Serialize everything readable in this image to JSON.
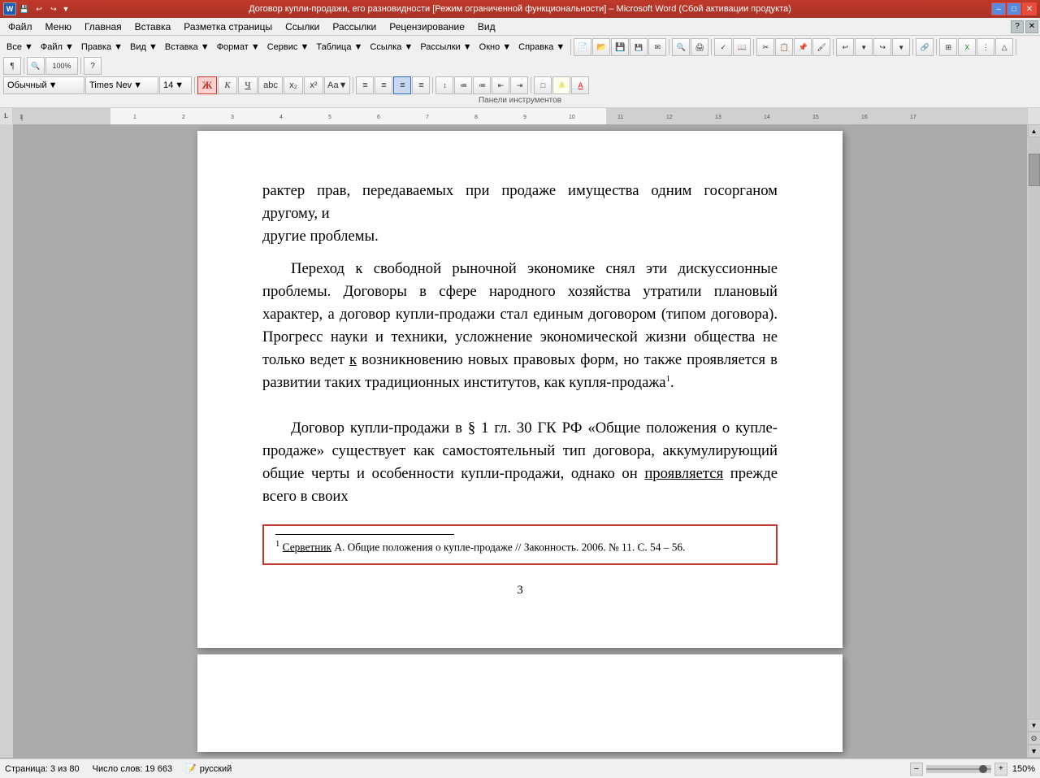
{
  "titlebar": {
    "title": "Договор купли-продажи, его разновидности [Режим ограниченной функциональности] – Microsoft Word (Сбой активации продукта)",
    "min_label": "–",
    "max_label": "□",
    "close_label": "✕"
  },
  "menubar": {
    "items": [
      "Файл",
      "Меню",
      "Главная",
      "Вставка",
      "Разметка страницы",
      "Ссылки",
      "Рассылки",
      "Рецензирование",
      "Вид"
    ]
  },
  "ribbon": {
    "items": [
      "Все▼",
      "Файл▼",
      "Правка▼",
      "Вид▼",
      "Вставка▼",
      "Формат▼",
      "Сервис▼",
      "Таблица▼",
      "Ссылка▼",
      "Рассылки▼",
      "Окно▼",
      "Справка▼"
    ],
    "help_icon": "?"
  },
  "format_toolbar": {
    "style_label": "Обычный",
    "font_label": "Times Nev",
    "size_label": "14",
    "bold_label": "Ж",
    "italic_label": "К",
    "underline_label": "Ч",
    "strikethrough_label": "аbс",
    "sub_label": "х₂",
    "sup_label": "х²",
    "case_label": "Аа▼",
    "toolbar_label": "Панели инструментов"
  },
  "document": {
    "page_number": "3",
    "paragraphs": [
      {
        "id": "p1",
        "indent": false,
        "text": "рактер прав, передаваемых при продаже имущества одним госорганом другому, и"
      },
      {
        "id": "p2",
        "indent": false,
        "text": "другие проблемы."
      },
      {
        "id": "p3",
        "indent": true,
        "text": "Переход к свободной рыночной экономике снял эти дискуссионные проблемы. Договоры в сфере народного хозяйства утратили плановый характер, а договор купли-продажи стал единым договором (типом договора). Прогресс науки и техники, усложнение экономической жизни общества не только ведет"
      },
      {
        "id": "p3_end",
        "underline_word": "к",
        "rest": " возникновению новых правовых форм, но также проявляется в развитии таких традиционных институтов, как купля-продажа",
        "footnote_marker": "1",
        "period": "."
      },
      {
        "id": "p4",
        "indent": true,
        "text": "Договор купли-продажи в § 1 гл. 30 ГК РФ «Общие положения о купле-продаже» существует как самостоятельный тип договора, аккумулирующий общие черты и особенности купли-продажи, однако он"
      },
      {
        "id": "p4_end",
        "underline_word": "проявляется",
        "rest": " прежде всего в своих"
      }
    ],
    "footnote": {
      "marker": "1",
      "text": "Серветник А. Общие положения о купле-продаже // Законность. 2006. № 11. С. 54 – 56.",
      "underline_part": "Серветник"
    }
  },
  "statusbar": {
    "page_info": "Страница: 3 из 80",
    "word_count": "Число слов: 19 663",
    "language": "русский",
    "zoom_level": "150%",
    "zoom_minus": "–",
    "zoom_plus": "+"
  }
}
